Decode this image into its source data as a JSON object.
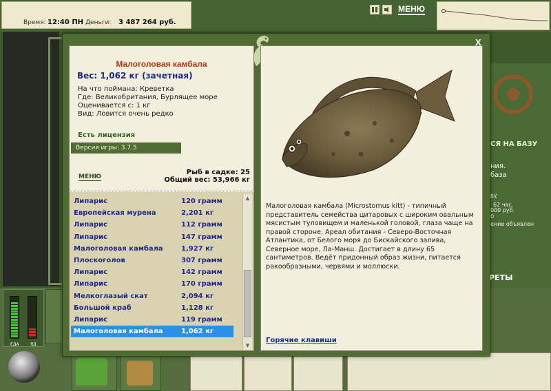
{
  "status": {
    "time_label": "Время:",
    "time_value": "12:40 ПН",
    "money_label": "Деньги:",
    "money_value": "3 487 264 руб."
  },
  "topbar": {
    "pause_icon": "pause-icon",
    "sound_icon": "sound-icon",
    "menu_label": "МЕНЮ"
  },
  "background": {
    "base_title": "СЯ НА БАЗУ",
    "lines": [
      "ния.",
      "база"
    ],
    "small": [
      "ку",
      "62 час.",
      "000 руб.",
      "0",
      "ение объявлен"
    ],
    "bottom_label": "РЕТЫ",
    "meter_food": "ЕДА",
    "meter_poison": "ЯД"
  },
  "dialog": {
    "close_label": "X",
    "fish_name": "Малоголовая камбала",
    "weight_line": "Вес: 1,062 кг (зачетная)",
    "info": [
      "На что поймана: Креветка",
      "Где: Великобритания, Бурлящее море",
      "Оценивается с: 1 кг",
      "Вид: Ловится очень редко"
    ],
    "license": "Есть лицензия",
    "version": "Версия игры: 3.7.5",
    "menu_link": "МЕНЮ",
    "keep_count": "Рыб в садке: 25",
    "keep_weight": "Общий вес: 53,966 кг",
    "catch_list": [
      {
        "name": "Липарис",
        "weight": "120 грамм"
      },
      {
        "name": "Европейская мурена",
        "weight": "2,201 кг"
      },
      {
        "name": "Липарис",
        "weight": "112 грамм"
      },
      {
        "name": "Липарис",
        "weight": "147 грамм"
      },
      {
        "name": "Малоголовая камбала",
        "weight": "1,927 кг"
      },
      {
        "name": "Плоскоголов",
        "weight": "307 грамм"
      },
      {
        "name": "Липарис",
        "weight": "142 грамм"
      },
      {
        "name": "Липарис",
        "weight": "170 грамм"
      },
      {
        "name": "Мелкоглазый скат",
        "weight": "2,094 кг"
      },
      {
        "name": "Большой краб",
        "weight": "1,128 кг"
      },
      {
        "name": "Липарис",
        "weight": "119 грамм"
      },
      {
        "name": "Малоголовая камбала",
        "weight": "1,062 кг"
      }
    ],
    "selected_index": 11,
    "description": "Малоголовая камбала (Microstomus kitt) - типичный представитель семейства цитаровых с широким овальным мясистым туловищем и маленькой головой, глаза чаще на правой стороне. Ареал обитания - Северо-Восточная Атлантика, от Белого моря до Бискайского залива, Северное море, Ла-Манш. Достигает в длину 65 сантиметров. Ведёт придонный образ жизни, питается ракообразными, червями и моллюски.",
    "hotkeys": "Горячие клавиши"
  },
  "colors": {
    "frame_green": "#4f6c33",
    "paper": "#f2efdf",
    "title_red": "#b23a10",
    "list_blue": "#22288a",
    "selected": "#2e8fe8"
  }
}
